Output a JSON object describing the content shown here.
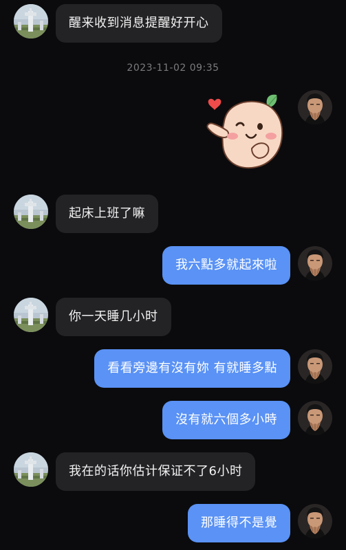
{
  "chat": {
    "timestamp": "2023-11-02 09:35",
    "messages": [
      {
        "sender": "other",
        "text": "醒来收到消息提醒好开心"
      },
      {
        "sender": "me",
        "type": "sticker",
        "sticker": "peach-sticker"
      },
      {
        "sender": "other",
        "text": "起床上班了嘛"
      },
      {
        "sender": "me",
        "text": "我六點多就起來啦"
      },
      {
        "sender": "other",
        "text": "你一天睡几小时"
      },
      {
        "sender": "me",
        "text": "看看旁邊有沒有妳 有就睡多點"
      },
      {
        "sender": "me",
        "text": "沒有就六個多小時"
      },
      {
        "sender": "other",
        "text": "我在的话你估计保证不了6小时"
      },
      {
        "sender": "me",
        "text": "那睡得不是覺"
      }
    ]
  },
  "colors": {
    "background": "#0b0b0d",
    "incoming_bubble": "#232326",
    "outgoing_bubble": "#5a92f5",
    "timestamp_text": "#7c7c80"
  }
}
